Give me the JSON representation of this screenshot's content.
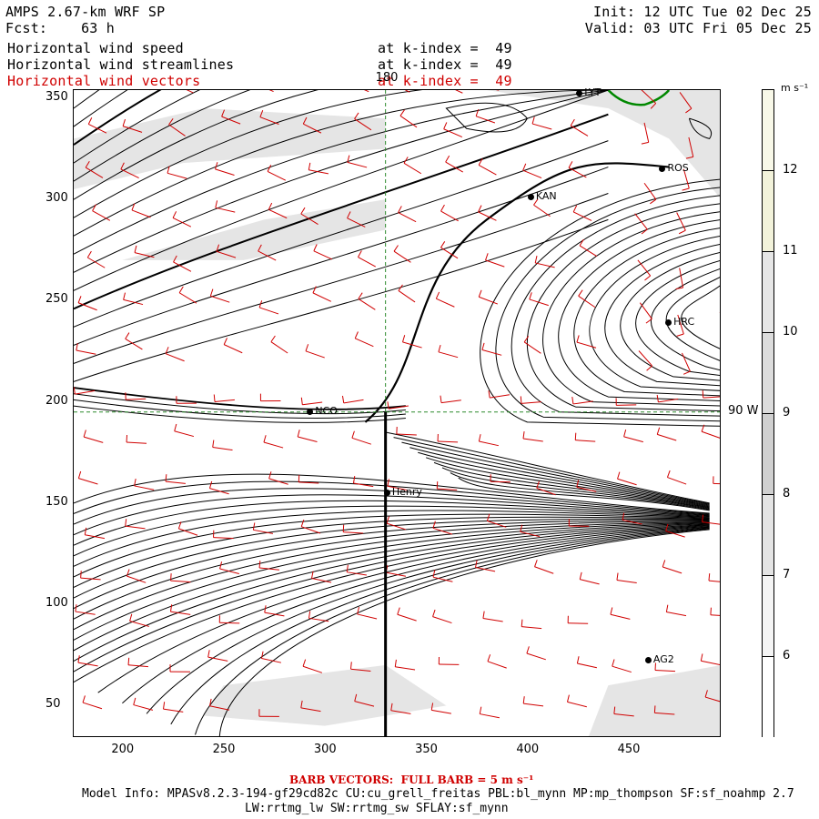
{
  "header": {
    "title": "AMPS 2.67-km WRF SP",
    "forecast": "Fcst:    63 h",
    "init": "Init: 12 UTC Tue 02 Dec 25",
    "valid": "Valid: 03 UTC Fri 05 Dec 25",
    "fields": [
      {
        "name": "Horizontal wind speed",
        "level": "at k-index =  49",
        "color": "#000000"
      },
      {
        "name": "Horizontal wind streamlines",
        "level": "at k-index =  49",
        "color": "#000000"
      },
      {
        "name": "Horizontal wind vectors",
        "level": "at k-index =  49",
        "color": "#d00000"
      }
    ]
  },
  "map": {
    "x_ticks": [
      "200",
      "250",
      "300",
      "350",
      "400",
      "450"
    ],
    "y_ticks": [
      "350",
      "300",
      "250",
      "200",
      "150",
      "100",
      "50"
    ],
    "x_range": [
      176,
      496
    ],
    "y_range": [
      34,
      354
    ],
    "meridian_label": "180",
    "parallel_label": "90 W",
    "meridian_x": 330,
    "parallel_y": 195,
    "stations": [
      {
        "name": "LYT",
        "x": 426,
        "y": 352
      },
      {
        "name": "ROS",
        "x": 467,
        "y": 315
      },
      {
        "name": "KAN",
        "x": 402,
        "y": 301
      },
      {
        "name": "HRC",
        "x": 470,
        "y": 239
      },
      {
        "name": "NCO",
        "x": 293,
        "y": 195
      },
      {
        "name": "Henry",
        "x": 331,
        "y": 155
      },
      {
        "name": "AG2",
        "x": 460,
        "y": 72
      }
    ],
    "colors": {
      "streamline": "#000000",
      "barb": "#d00000",
      "grid": "#2e8b2e",
      "shade_light": "#e0e0e0",
      "shade_mid": "#c8c8c8",
      "contour_green": "#008800"
    }
  },
  "colorbar": {
    "unit": "m s⁻¹",
    "labels": [
      "12",
      "11",
      "10",
      "9",
      "8",
      "7",
      "6"
    ],
    "colors": [
      "#f8f8e8",
      "#f2f2da",
      "#e6e6e6",
      "#dcdcdc",
      "#d0d0d0",
      "#e4e4e4",
      "#f4f4f4",
      "#ffffff"
    ]
  },
  "footer": {
    "barb_note": "BARB VECTORS:  FULL BARB = 5 m s⁻¹",
    "model_info": "Model Info: MPASv8.2.3-194-gf29cd82c CU:cu_grell_freitas PBL:bl_mynn MP:mp_thompson SF:sf_noahmp 2.7",
    "physics": "LW:rrtmg_lw SW:rrtmg_sw SFLAY:sf_mynn"
  }
}
